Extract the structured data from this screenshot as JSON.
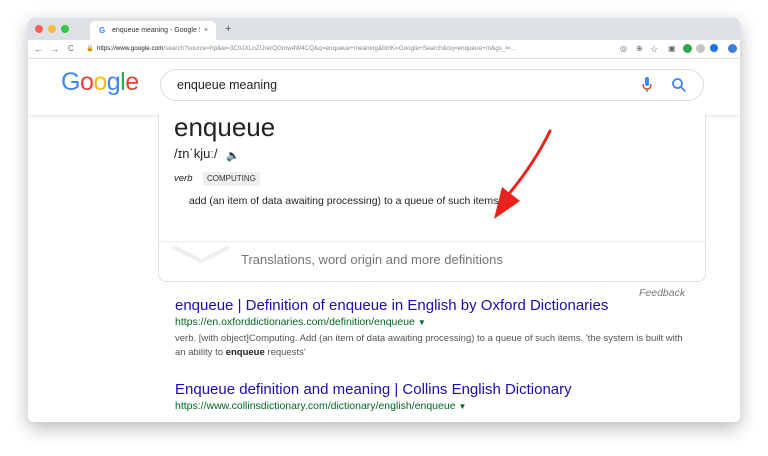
{
  "browser": {
    "tab_title": "enqueue meaning - Google Se...",
    "tab_favicon": "G",
    "tab_close": "×",
    "new_tab": "+",
    "nav": {
      "back": "←",
      "forward": "→",
      "reload": "C"
    },
    "url_host": "https://www.google.com",
    "url_path": "/search?source=hp&ei=3C0JXLnZIJrerQGmw4W4CQ&q=enqueue+meaning&btnK=Google+Search&oq=enqueue+m&gs_l=...",
    "colors": {
      "close": "#fc605c",
      "minimize": "#fdbc40",
      "maximize": "#34c84a"
    }
  },
  "google": {
    "logo_letters": [
      {
        "ch": "G",
        "color": "#4285f4"
      },
      {
        "ch": "o",
        "color": "#ea4335"
      },
      {
        "ch": "o",
        "color": "#fbbc05"
      },
      {
        "ch": "g",
        "color": "#4285f4"
      },
      {
        "ch": "l",
        "color": "#34a853"
      },
      {
        "ch": "e",
        "color": "#ea4335"
      }
    ],
    "search_query": "enqueue meaning"
  },
  "dictionary": {
    "word": "enqueue",
    "phonetic": "/ɪnˈkjuː/",
    "part_of_speech": "verb",
    "domain_label": "COMPUTING",
    "definition": "add (an item of data awaiting processing) to a queue of such items.",
    "more_link": "Translations, word origin and more definitions"
  },
  "feedback": "Feedback",
  "results": [
    {
      "title": "enqueue | Definition of enqueue in English by Oxford Dictionaries",
      "url": "https://en.oxforddictionaries.com/definition/enqueue",
      "snippet_before": "verb. [with object]Computing. Add (an item of data awaiting processing) to a queue of such items. 'the system is built with an ability to ",
      "snippet_bold": "enqueue",
      "snippet_after": " requests'"
    },
    {
      "title": "Enqueue definition and meaning | Collins English Dictionary",
      "url": "https://www.collinsdictionary.com/dictionary/english/enqueue"
    }
  ],
  "annotation": {
    "arrow_color": "#e8231e"
  }
}
